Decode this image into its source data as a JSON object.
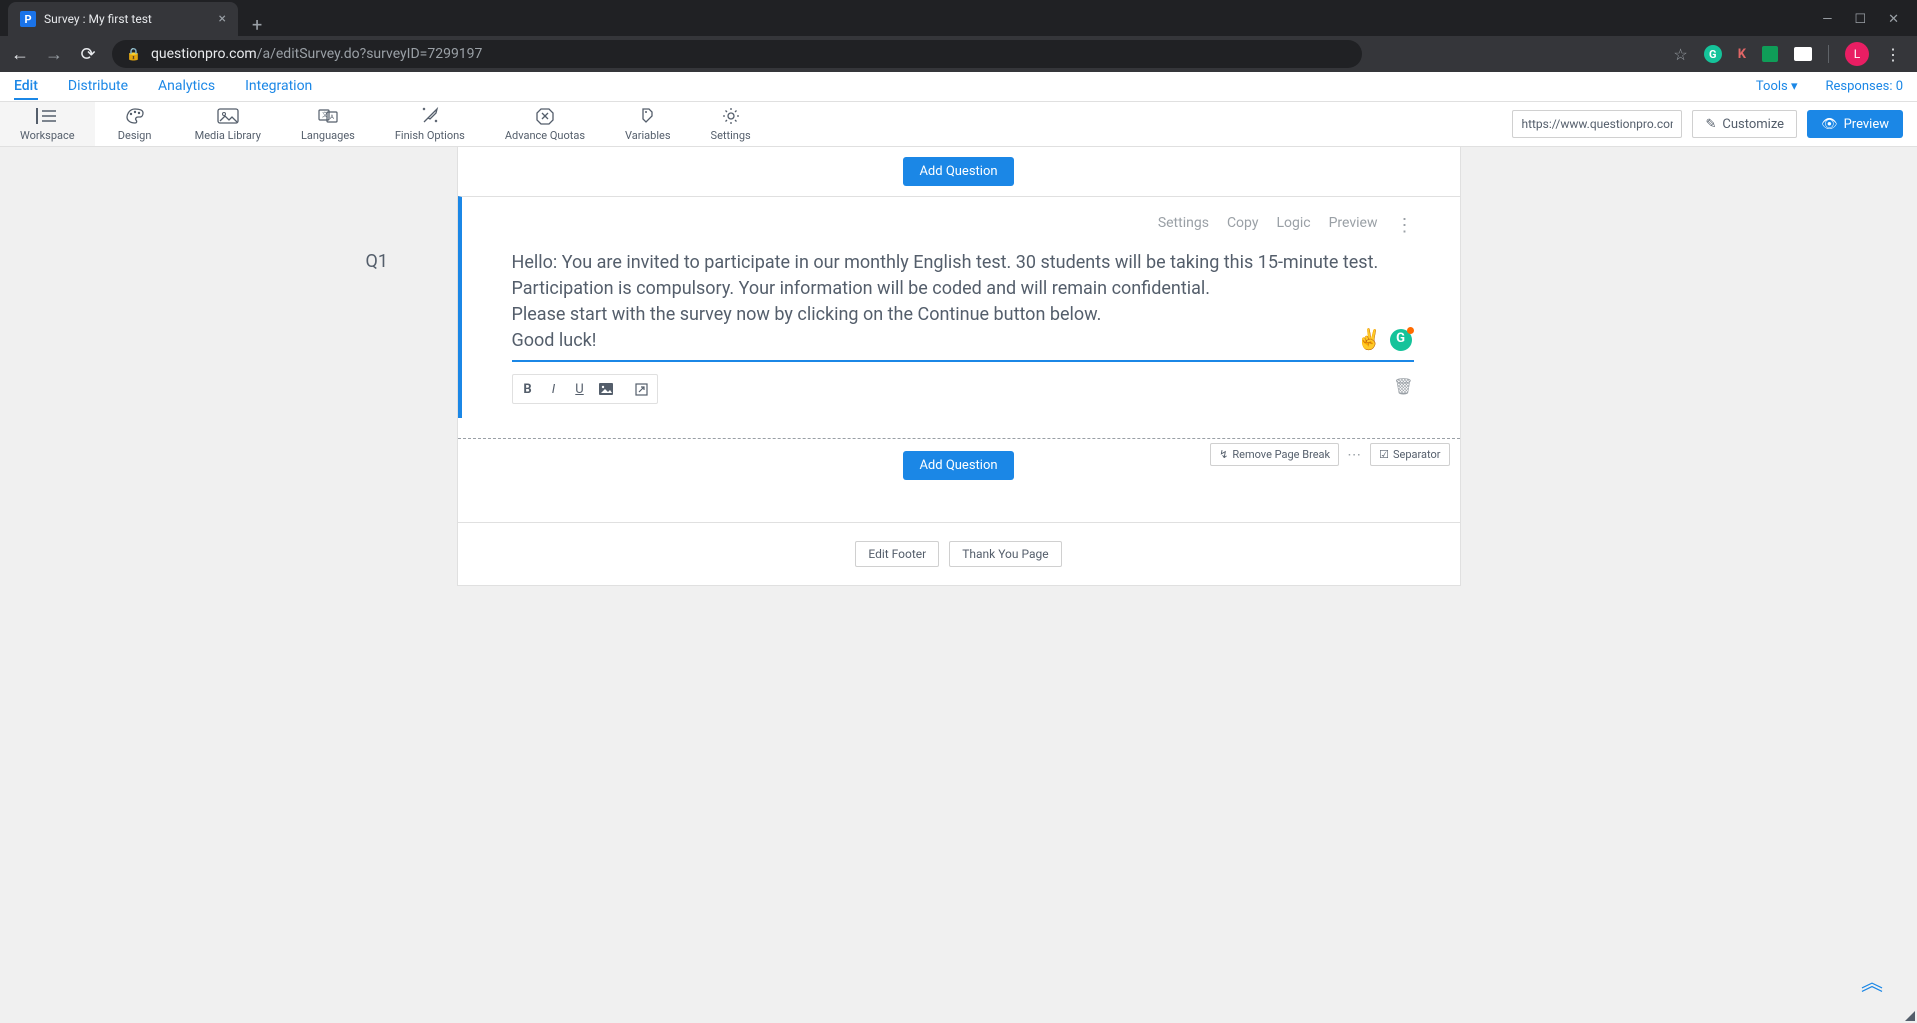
{
  "browser": {
    "tab_title": "Survey : My first test",
    "url_domain": "questionpro.com",
    "url_path": "/a/editSurvey.do?surveyID=7299197",
    "profile_letter": "L",
    "ext_k": "K"
  },
  "top_nav": {
    "items": [
      "Edit",
      "Distribute",
      "Analytics",
      "Integration"
    ],
    "tools": "Tools",
    "responses_label": "Responses: 0"
  },
  "toolbar": {
    "items": [
      {
        "label": "Workspace"
      },
      {
        "label": "Design"
      },
      {
        "label": "Media Library"
      },
      {
        "label": "Languages"
      },
      {
        "label": "Finish Options"
      },
      {
        "label": "Advance Quotas"
      },
      {
        "label": "Variables"
      },
      {
        "label": "Settings"
      }
    ],
    "share_url": "https://www.questionpro.com",
    "customize": "Customize",
    "preview": "Preview"
  },
  "canvas": {
    "add_question": "Add Question",
    "q_label": "Q1",
    "q_actions": {
      "settings": "Settings",
      "copy": "Copy",
      "logic": "Logic",
      "preview": "Preview"
    },
    "q_text_line1": "Hello: You are invited to participate in our monthly English test. 30 students will be taking this 15-minute test. Participation is compulsory. Your information will be coded and will remain confidential.",
    "q_text_line2": "Please start with the survey now by clicking on the Continue button below.",
    "q_text_line3": "Good luck!",
    "badge_emoji": "✌️",
    "badge_g": "G",
    "remove_pb": "Remove Page Break",
    "separator": "Separator",
    "edit_footer": "Edit Footer",
    "thank_you": "Thank You Page"
  }
}
